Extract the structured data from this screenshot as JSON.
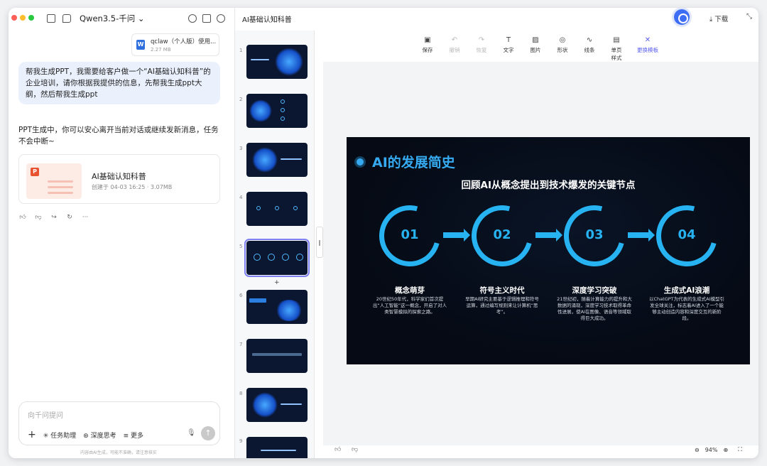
{
  "chat": {
    "model_name": "Qwen3.5-千问",
    "attachment": {
      "name": "qclaw（个人版）使用...",
      "size": "2.27 MB",
      "icon": "word-doc-icon"
    },
    "user_message": "帮我生成PPT，我需要给客户做一个“AI基础认知科普”的企业培训，请你根据我提供的信息，先帮我生成ppt大纲，然后帮我生成ppt",
    "ai_message": "PPT生成中，你可以安心离开当前对话或继续发新消息，任务不会中断~",
    "ppt_card": {
      "title": "AI基础认知科普",
      "meta": "创建于 04-03 16:25 · 3.07MB"
    },
    "input_placeholder": "向千问提问",
    "tools": [
      {
        "label": "任务助理",
        "icon": "sparkle-icon"
      },
      {
        "label": "深度思考",
        "icon": "brain-icon"
      },
      {
        "label": "更多",
        "icon": "list-icon"
      }
    ],
    "footnote": "内容由AI生成，可能不准确，请注意核实"
  },
  "editor": {
    "doc_title": "AI基础认知科普",
    "download_label": "下载",
    "toolbar": [
      {
        "label": "保存",
        "icon": "save-icon",
        "glyph": "▣",
        "disabled": false
      },
      {
        "label": "撤销",
        "icon": "undo-icon",
        "glyph": "↶",
        "disabled": true
      },
      {
        "label": "恢复",
        "icon": "redo-icon",
        "glyph": "↷",
        "disabled": true
      },
      {
        "label": "文字",
        "icon": "text-icon",
        "glyph": "T",
        "disabled": false
      },
      {
        "label": "图片",
        "icon": "image-icon",
        "glyph": "▨",
        "disabled": false
      },
      {
        "label": "形状",
        "icon": "shape-icon",
        "glyph": "◎",
        "disabled": false
      },
      {
        "label": "线条",
        "icon": "line-icon",
        "glyph": "∿",
        "disabled": false
      },
      {
        "label": "单页样式",
        "icon": "layout-icon",
        "glyph": "▤",
        "disabled": false
      },
      {
        "label": "更换模板",
        "icon": "template-icon",
        "glyph": "✕",
        "disabled": false,
        "accent": true
      }
    ],
    "thumbnails": [
      "1",
      "2",
      "3",
      "4",
      "5",
      "6",
      "7",
      "8",
      "9"
    ],
    "selected_slide": "5",
    "zoom": "94%"
  },
  "slide": {
    "heading": "AI的发展简史",
    "subtitle": "回顾AI从概念提出到技术爆发的关键节点",
    "stages": [
      {
        "num": "01",
        "title": "概念萌芽",
        "desc": "20世纪50年代，科学家们首次提出“人工智能”这一概念，开启了对人类智慧模拟的探索之路。"
      },
      {
        "num": "02",
        "title": "符号主义时代",
        "desc": "早期AI研究主要基于逻辑推理和符号运算，通过编写规则来让计算机“思考”。"
      },
      {
        "num": "03",
        "title": "深度学习突破",
        "desc": "21世纪初，随着计算能力的提升和大数据的涌现，深度学习技术取得革命性进展，使AI在图像、语音等领域取得巨大成功。"
      },
      {
        "num": "04",
        "title": "生成式AI浪潮",
        "desc": "以ChatGPT为代表的生成式AI模型引发全球关注，标志着AI进入了一个能够主动创造内容和深度交互的新阶段。"
      }
    ],
    "accent_color": "#27b3f2"
  }
}
